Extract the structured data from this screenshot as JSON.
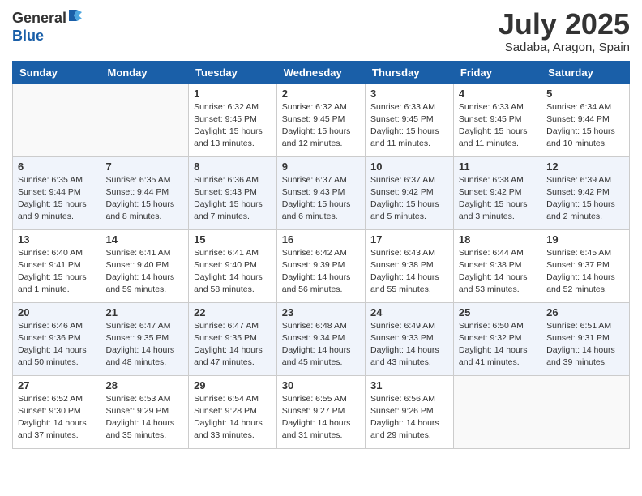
{
  "logo": {
    "line1": "General",
    "line2": "Blue"
  },
  "title": "July 2025",
  "location": "Sadaba, Aragon, Spain",
  "days_of_week": [
    "Sunday",
    "Monday",
    "Tuesday",
    "Wednesday",
    "Thursday",
    "Friday",
    "Saturday"
  ],
  "weeks": [
    [
      {
        "day": "",
        "info": ""
      },
      {
        "day": "",
        "info": ""
      },
      {
        "day": "1",
        "info": "Sunrise: 6:32 AM\nSunset: 9:45 PM\nDaylight: 15 hours\nand 13 minutes."
      },
      {
        "day": "2",
        "info": "Sunrise: 6:32 AM\nSunset: 9:45 PM\nDaylight: 15 hours\nand 12 minutes."
      },
      {
        "day": "3",
        "info": "Sunrise: 6:33 AM\nSunset: 9:45 PM\nDaylight: 15 hours\nand 11 minutes."
      },
      {
        "day": "4",
        "info": "Sunrise: 6:33 AM\nSunset: 9:45 PM\nDaylight: 15 hours\nand 11 minutes."
      },
      {
        "day": "5",
        "info": "Sunrise: 6:34 AM\nSunset: 9:44 PM\nDaylight: 15 hours\nand 10 minutes."
      }
    ],
    [
      {
        "day": "6",
        "info": "Sunrise: 6:35 AM\nSunset: 9:44 PM\nDaylight: 15 hours\nand 9 minutes."
      },
      {
        "day": "7",
        "info": "Sunrise: 6:35 AM\nSunset: 9:44 PM\nDaylight: 15 hours\nand 8 minutes."
      },
      {
        "day": "8",
        "info": "Sunrise: 6:36 AM\nSunset: 9:43 PM\nDaylight: 15 hours\nand 7 minutes."
      },
      {
        "day": "9",
        "info": "Sunrise: 6:37 AM\nSunset: 9:43 PM\nDaylight: 15 hours\nand 6 minutes."
      },
      {
        "day": "10",
        "info": "Sunrise: 6:37 AM\nSunset: 9:42 PM\nDaylight: 15 hours\nand 5 minutes."
      },
      {
        "day": "11",
        "info": "Sunrise: 6:38 AM\nSunset: 9:42 PM\nDaylight: 15 hours\nand 3 minutes."
      },
      {
        "day": "12",
        "info": "Sunrise: 6:39 AM\nSunset: 9:42 PM\nDaylight: 15 hours\nand 2 minutes."
      }
    ],
    [
      {
        "day": "13",
        "info": "Sunrise: 6:40 AM\nSunset: 9:41 PM\nDaylight: 15 hours\nand 1 minute."
      },
      {
        "day": "14",
        "info": "Sunrise: 6:41 AM\nSunset: 9:40 PM\nDaylight: 14 hours\nand 59 minutes."
      },
      {
        "day": "15",
        "info": "Sunrise: 6:41 AM\nSunset: 9:40 PM\nDaylight: 14 hours\nand 58 minutes."
      },
      {
        "day": "16",
        "info": "Sunrise: 6:42 AM\nSunset: 9:39 PM\nDaylight: 14 hours\nand 56 minutes."
      },
      {
        "day": "17",
        "info": "Sunrise: 6:43 AM\nSunset: 9:38 PM\nDaylight: 14 hours\nand 55 minutes."
      },
      {
        "day": "18",
        "info": "Sunrise: 6:44 AM\nSunset: 9:38 PM\nDaylight: 14 hours\nand 53 minutes."
      },
      {
        "day": "19",
        "info": "Sunrise: 6:45 AM\nSunset: 9:37 PM\nDaylight: 14 hours\nand 52 minutes."
      }
    ],
    [
      {
        "day": "20",
        "info": "Sunrise: 6:46 AM\nSunset: 9:36 PM\nDaylight: 14 hours\nand 50 minutes."
      },
      {
        "day": "21",
        "info": "Sunrise: 6:47 AM\nSunset: 9:35 PM\nDaylight: 14 hours\nand 48 minutes."
      },
      {
        "day": "22",
        "info": "Sunrise: 6:47 AM\nSunset: 9:35 PM\nDaylight: 14 hours\nand 47 minutes."
      },
      {
        "day": "23",
        "info": "Sunrise: 6:48 AM\nSunset: 9:34 PM\nDaylight: 14 hours\nand 45 minutes."
      },
      {
        "day": "24",
        "info": "Sunrise: 6:49 AM\nSunset: 9:33 PM\nDaylight: 14 hours\nand 43 minutes."
      },
      {
        "day": "25",
        "info": "Sunrise: 6:50 AM\nSunset: 9:32 PM\nDaylight: 14 hours\nand 41 minutes."
      },
      {
        "day": "26",
        "info": "Sunrise: 6:51 AM\nSunset: 9:31 PM\nDaylight: 14 hours\nand 39 minutes."
      }
    ],
    [
      {
        "day": "27",
        "info": "Sunrise: 6:52 AM\nSunset: 9:30 PM\nDaylight: 14 hours\nand 37 minutes."
      },
      {
        "day": "28",
        "info": "Sunrise: 6:53 AM\nSunset: 9:29 PM\nDaylight: 14 hours\nand 35 minutes."
      },
      {
        "day": "29",
        "info": "Sunrise: 6:54 AM\nSunset: 9:28 PM\nDaylight: 14 hours\nand 33 minutes."
      },
      {
        "day": "30",
        "info": "Sunrise: 6:55 AM\nSunset: 9:27 PM\nDaylight: 14 hours\nand 31 minutes."
      },
      {
        "day": "31",
        "info": "Sunrise: 6:56 AM\nSunset: 9:26 PM\nDaylight: 14 hours\nand 29 minutes."
      },
      {
        "day": "",
        "info": ""
      },
      {
        "day": "",
        "info": ""
      }
    ]
  ]
}
